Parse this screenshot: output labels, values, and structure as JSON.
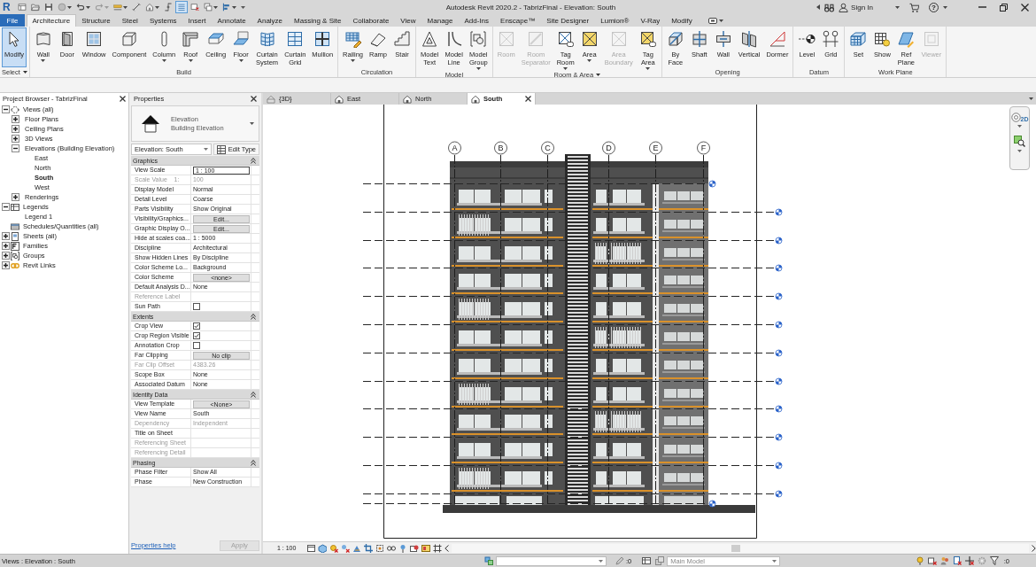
{
  "title_bar": {
    "logo": "R",
    "quick_access": [
      {
        "dropdown": false,
        "disabled": false,
        "on": false
      },
      {
        "dropdown": false,
        "disabled": false,
        "on": false
      },
      {
        "dropdown": false,
        "disabled": false,
        "on": false
      },
      {
        "dropdown": true,
        "disabled": false,
        "on": false
      },
      {
        "dropdown": true,
        "disabled": false,
        "on": false
      },
      {
        "dropdown": true,
        "disabled": true,
        "on": false
      },
      {
        "dropdown": true,
        "disabled": false,
        "on": false
      },
      {
        "dropdown": false,
        "disabled": false,
        "on": false
      },
      {
        "dropdown": true,
        "disabled": false,
        "on": false
      },
      {
        "dropdown": false,
        "disabled": false,
        "on": false
      },
      {
        "dropdown": false,
        "disabled": false,
        "on": true
      },
      {
        "dropdown": false,
        "disabled": false,
        "on": false
      },
      {
        "dropdown": true,
        "disabled": false,
        "on": false
      },
      {
        "dropdown": true,
        "disabled": false,
        "on": false
      }
    ],
    "title": "Autodesk Revit 2020.2 - TabrizFinal - Elevation: South",
    "sign_in": "Sign In",
    "help": "?"
  },
  "ribbon": {
    "tabs": [
      {
        "label": "File",
        "kind": "application",
        "selected": false
      },
      {
        "label": "Architecture",
        "kind": "tab",
        "selected": true
      },
      {
        "label": "Structure",
        "kind": "tab",
        "selected": false
      },
      {
        "label": "Steel",
        "kind": "tab",
        "selected": false
      },
      {
        "label": "Systems",
        "kind": "tab",
        "selected": false
      },
      {
        "label": "Insert",
        "kind": "tab",
        "selected": false
      },
      {
        "label": "Annotate",
        "kind": "tab",
        "selected": false
      },
      {
        "label": "Analyze",
        "kind": "tab",
        "selected": false
      },
      {
        "label": "Massing & Site",
        "kind": "tab",
        "selected": false
      },
      {
        "label": "Collaborate",
        "kind": "tab",
        "selected": false
      },
      {
        "label": "View",
        "kind": "tab",
        "selected": false
      },
      {
        "label": "Manage",
        "kind": "tab",
        "selected": false
      },
      {
        "label": "Add-Ins",
        "kind": "tab",
        "selected": false
      },
      {
        "label": "Enscape™",
        "kind": "tab",
        "selected": false
      },
      {
        "label": "Site Designer",
        "kind": "tab",
        "selected": false
      },
      {
        "label": "Lumion®",
        "kind": "tab",
        "selected": false
      },
      {
        "label": "V-Ray",
        "kind": "tab",
        "selected": false
      },
      {
        "label": "Modify",
        "kind": "tab",
        "selected": false
      }
    ],
    "panels": [
      {
        "title": "Select",
        "dropdown": true,
        "buttons": [
          {
            "label": "Modify",
            "active": true,
            "disabled": false,
            "dropdown": false
          }
        ]
      },
      {
        "title": "Build",
        "dropdown": false,
        "buttons": [
          {
            "label": "Wall",
            "active": false,
            "disabled": false,
            "dropdown": true
          },
          {
            "label": "Door",
            "active": false,
            "disabled": false,
            "dropdown": false
          },
          {
            "label": "Window",
            "active": false,
            "disabled": false,
            "dropdown": false
          },
          {
            "label": "Component",
            "active": false,
            "disabled": false,
            "dropdown": false
          },
          {
            "label": "Column",
            "active": false,
            "disabled": false,
            "dropdown": true
          },
          {
            "label": "Roof",
            "active": false,
            "disabled": false,
            "dropdown": true
          },
          {
            "label": "Ceiling",
            "active": false,
            "disabled": false,
            "dropdown": false
          },
          {
            "label": "Floor",
            "active": false,
            "disabled": false,
            "dropdown": true
          },
          {
            "label": "Curtain System",
            "active": false,
            "disabled": false,
            "dropdown": false
          },
          {
            "label": "Curtain Grid",
            "active": false,
            "disabled": false,
            "dropdown": false
          },
          {
            "label": "Mullion",
            "active": false,
            "disabled": false,
            "dropdown": false
          }
        ]
      },
      {
        "title": "Circulation",
        "dropdown": false,
        "buttons": [
          {
            "label": "Railing",
            "active": false,
            "disabled": false,
            "dropdown": true
          },
          {
            "label": "Ramp",
            "active": false,
            "disabled": false,
            "dropdown": false
          },
          {
            "label": "Stair",
            "active": false,
            "disabled": false,
            "dropdown": false
          }
        ]
      },
      {
        "title": "Model",
        "dropdown": false,
        "buttons": [
          {
            "label": "Model Text",
            "active": false,
            "disabled": false,
            "dropdown": false
          },
          {
            "label": "Model Line",
            "active": false,
            "disabled": false,
            "dropdown": false
          },
          {
            "label": "Model Group",
            "active": false,
            "disabled": false,
            "dropdown": true
          }
        ]
      },
      {
        "title": "Room & Area",
        "dropdown": true,
        "buttons": [
          {
            "label": "Room",
            "active": false,
            "disabled": true,
            "dropdown": false
          },
          {
            "label": "Room Separator",
            "active": false,
            "disabled": true,
            "dropdown": false
          },
          {
            "label": "Tag Room",
            "active": false,
            "disabled": false,
            "dropdown": true
          },
          {
            "label": "Area",
            "active": false,
            "disabled": false,
            "dropdown": true
          },
          {
            "label": "Area Boundary",
            "active": false,
            "disabled": true,
            "dropdown": false
          },
          {
            "label": "Tag Area",
            "active": false,
            "disabled": false,
            "dropdown": true
          }
        ]
      },
      {
        "title": "Opening",
        "dropdown": false,
        "buttons": [
          {
            "label": "By Face",
            "active": false,
            "disabled": false,
            "dropdown": false
          },
          {
            "label": "Shaft",
            "active": false,
            "disabled": false,
            "dropdown": false
          },
          {
            "label": "Wall",
            "active": false,
            "disabled": false,
            "dropdown": false
          },
          {
            "label": "Vertical",
            "active": false,
            "disabled": false,
            "dropdown": false
          },
          {
            "label": "Dormer",
            "active": false,
            "disabled": false,
            "dropdown": false
          }
        ]
      },
      {
        "title": "Datum",
        "dropdown": false,
        "buttons": [
          {
            "label": "Level",
            "active": false,
            "disabled": false,
            "dropdown": false
          },
          {
            "label": "Grid",
            "active": false,
            "disabled": false,
            "dropdown": false
          }
        ]
      },
      {
        "title": "Work Plane",
        "dropdown": false,
        "buttons": [
          {
            "label": "Set",
            "active": false,
            "disabled": false,
            "dropdown": false
          },
          {
            "label": "Show",
            "active": false,
            "disabled": false,
            "dropdown": false
          },
          {
            "label": "Ref Plane",
            "active": false,
            "disabled": false,
            "dropdown": false
          },
          {
            "label": "Viewer",
            "active": false,
            "disabled": true,
            "dropdown": false
          }
        ]
      }
    ]
  },
  "project_browser": {
    "title": "Project Browser - TabrizFinal",
    "items": [
      {
        "label": "Views (all)",
        "kind": "views",
        "expanded": true,
        "selected": false,
        "children": [
          {
            "label": "Floor Plans",
            "expanded": false,
            "selected": false
          },
          {
            "label": "Ceiling Plans",
            "expanded": false,
            "selected": false
          },
          {
            "label": "3D Views",
            "expanded": false,
            "selected": false
          },
          {
            "label": "Elevations (Building Elevation)",
            "expanded": true,
            "selected": false,
            "children": [
              {
                "label": "East",
                "selected": false
              },
              {
                "label": "North",
                "selected": false
              },
              {
                "label": "South",
                "selected": true
              },
              {
                "label": "West",
                "selected": false
              }
            ]
          },
          {
            "label": "Renderings",
            "expanded": false,
            "selected": false
          }
        ]
      },
      {
        "label": "Legends",
        "kind": "legends",
        "expanded": true,
        "selected": false,
        "children": [
          {
            "label": "Legend 1",
            "selected": false
          }
        ]
      },
      {
        "label": "Schedules/Quantities (all)",
        "kind": "schedules",
        "selected": false
      },
      {
        "label": "Sheets (all)",
        "kind": "sheets",
        "expanded": false,
        "selected": false
      },
      {
        "label": "Families",
        "kind": "families",
        "expanded": false,
        "selected": false
      },
      {
        "label": "Groups",
        "kind": "groups",
        "expanded": false,
        "selected": false
      },
      {
        "label": "Revit Links",
        "kind": "links",
        "expanded": false,
        "selected": false
      }
    ]
  },
  "properties": {
    "title": "Properties",
    "family": "Elevation",
    "type": "Building Elevation",
    "instance": "Elevation: South",
    "edit_type": "Edit Type",
    "groups": [
      {
        "title": "Graphics",
        "expanded": true,
        "rows": [
          {
            "label": "View Scale",
            "kind": "field",
            "value": "1 : 100",
            "disabled": false
          },
          {
            "label": "Scale Value    1:",
            "kind": "text",
            "value": "100",
            "disabled": true
          },
          {
            "label": "Display Model",
            "kind": "text",
            "value": "Normal",
            "disabled": false
          },
          {
            "label": "Detail Level",
            "kind": "text",
            "value": "Coarse",
            "disabled": false
          },
          {
            "label": "Parts Visibility",
            "kind": "text",
            "value": "Show Original",
            "disabled": false
          },
          {
            "label": "Visibility/Graphics...",
            "kind": "button",
            "value": "Edit...",
            "disabled": false
          },
          {
            "label": "Graphic Display O...",
            "kind": "button",
            "value": "Edit...",
            "disabled": false
          },
          {
            "label": "Hide at scales coa...",
            "kind": "text",
            "value": "1 : 5000",
            "disabled": false
          },
          {
            "label": "Discipline",
            "kind": "text",
            "value": "Architectural",
            "disabled": false
          },
          {
            "label": "Show Hidden Lines",
            "kind": "text",
            "value": "By Discipline",
            "disabled": false
          },
          {
            "label": "Color Scheme Lo...",
            "kind": "text",
            "value": "Background",
            "disabled": false
          },
          {
            "label": "Color Scheme",
            "kind": "button",
            "value": "<none>",
            "disabled": false
          },
          {
            "label": "Default Analysis D...",
            "kind": "text",
            "value": "None",
            "disabled": false
          },
          {
            "label": "Reference Label",
            "kind": "text",
            "disabled": true
          },
          {
            "label": "Sun Path",
            "kind": "checkbox",
            "checked": false,
            "disabled": false
          }
        ]
      },
      {
        "title": "Extents",
        "expanded": true,
        "rows": [
          {
            "label": "Crop View",
            "kind": "checkbox",
            "checked": true,
            "disabled": false
          },
          {
            "label": "Crop Region Visible",
            "kind": "checkbox",
            "checked": true,
            "disabled": false
          },
          {
            "label": "Annotation Crop",
            "kind": "checkbox",
            "checked": false,
            "disabled": false
          },
          {
            "label": "Far Clipping",
            "kind": "button",
            "value": "No clip",
            "disabled": false
          },
          {
            "label": "Far Clip Offset",
            "kind": "text",
            "value": "4383.26",
            "disabled": true
          },
          {
            "label": "Scope Box",
            "kind": "text",
            "value": "None",
            "disabled": false
          },
          {
            "label": "Associated Datum",
            "kind": "text",
            "value": "None",
            "disabled": false
          }
        ]
      },
      {
        "title": "Identity Data",
        "expanded": true,
        "rows": [
          {
            "label": "View Template",
            "kind": "button",
            "value": "<None>",
            "disabled": false
          },
          {
            "label": "View Name",
            "kind": "text",
            "value": "South",
            "disabled": false
          },
          {
            "label": "Dependency",
            "kind": "text",
            "value": "Independent",
            "disabled": true
          },
          {
            "label": "Title on Sheet",
            "kind": "text",
            "disabled": false
          },
          {
            "label": "Referencing Sheet",
            "kind": "text",
            "disabled": true
          },
          {
            "label": "Referencing Detail",
            "kind": "text",
            "disabled": true
          }
        ]
      },
      {
        "title": "Phasing",
        "expanded": true,
        "rows": [
          {
            "label": "Phase Filter",
            "kind": "text",
            "value": "Show All",
            "disabled": false
          },
          {
            "label": "Phase",
            "kind": "text",
            "value": "New Construction",
            "disabled": false
          }
        ]
      }
    ],
    "help_link": "Properties help",
    "apply": {
      "label": "Apply",
      "disabled": true
    }
  },
  "view": {
    "tabs": [
      {
        "label": "{3D}",
        "kind": "isometric",
        "selected": false
      },
      {
        "label": "East",
        "kind": "elevation",
        "selected": false
      },
      {
        "label": "North",
        "kind": "elevation",
        "selected": false
      },
      {
        "label": "South",
        "kind": "elevation",
        "selected": true
      }
    ],
    "grids": [
      "A",
      "B",
      "C",
      "D",
      "E",
      "F"
    ],
    "nav_badge": "2D"
  },
  "view_control_bar": {
    "scale": "1 : 100"
  },
  "status_bar": {
    "message": "Views : Elevation : South",
    "editable_count": ":0",
    "design_option": "Main Model",
    "filter_count": ":0"
  }
}
